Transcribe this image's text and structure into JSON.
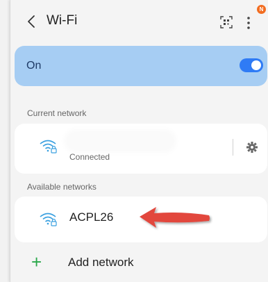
{
  "header": {
    "title": "Wi-Fi",
    "back_icon": "chevron-left-icon",
    "qr_icon": "qr-scan-icon",
    "more_icon": "more-vertical-icon",
    "badge": "N",
    "badge_color": "#f26d21"
  },
  "wifi_toggle": {
    "label": "On",
    "state": true,
    "bar_color": "#a6cdf3",
    "toggle_color": "#2f7bf5"
  },
  "current_network": {
    "section_title": "Current network",
    "status": "Connected",
    "settings_icon": "gear-icon"
  },
  "available_networks": {
    "section_title": "Available networks",
    "items": [
      {
        "name": "ACPL26",
        "icon": "wifi-lock-icon"
      }
    ]
  },
  "add_network": {
    "label": "Add network",
    "icon_color": "#2aa84a"
  },
  "annotation": {
    "arrow_color": "#e2463d"
  }
}
